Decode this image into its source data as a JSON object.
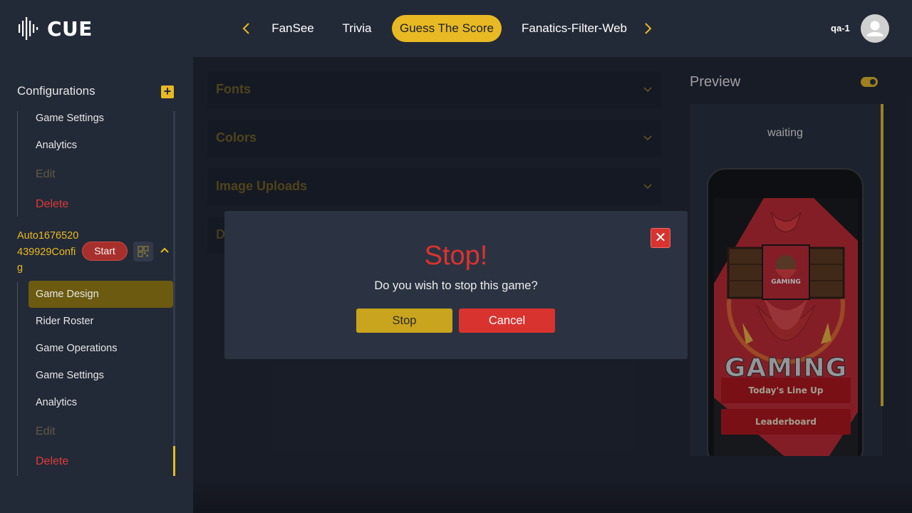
{
  "header": {
    "logo_text": "CUE",
    "tabs": [
      {
        "label": "FanSee",
        "active": false
      },
      {
        "label": "Trivia",
        "active": false
      },
      {
        "label": "Guess The Score",
        "active": true
      },
      {
        "label": "Fanatics-Filter-Web",
        "active": false
      }
    ],
    "user": "qa-1"
  },
  "sidebar": {
    "title": "Configurations",
    "group1": {
      "items": [
        "Game Settings",
        "Analytics"
      ],
      "edit": "Edit",
      "delete": "Delete"
    },
    "config_name": "Auto1676520439929Config",
    "start_label": "Start",
    "group2": {
      "items": [
        "Game Design",
        "Rider Roster",
        "Game Operations",
        "Game Settings",
        "Analytics"
      ],
      "active_item": "Game Design",
      "edit": "Edit",
      "delete": "Delete"
    }
  },
  "main": {
    "accordions": [
      "Fonts",
      "Colors",
      "Image Uploads",
      "Dialogs"
    ]
  },
  "preview": {
    "title": "Preview",
    "status": "waiting",
    "screen": {
      "sign_text": "GAMING",
      "big_text": "GAMING",
      "buttons": [
        "Today's Line Up",
        "Leaderboard"
      ]
    }
  },
  "modal": {
    "title": "Stop!",
    "message": "Do you wish to stop this game?",
    "confirm": "Stop",
    "cancel": "Cancel"
  },
  "colors": {
    "accent": "#e8b923",
    "danger": "#d9332f",
    "background": "#1b202b",
    "panel": "#232a37"
  }
}
